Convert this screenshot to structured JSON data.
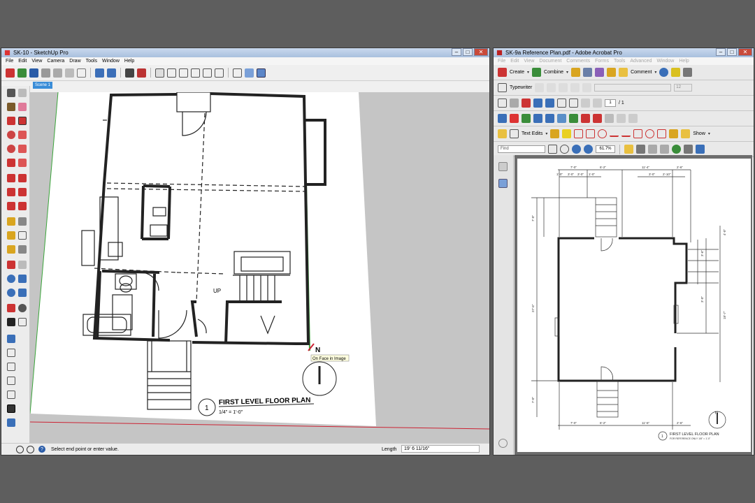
{
  "sketchup": {
    "title": "SK-10 - SketchUp Pro",
    "menu": [
      "File",
      "Edit",
      "View",
      "Camera",
      "Draw",
      "Tools",
      "Window",
      "Help"
    ],
    "scene_tab": "Scene 1",
    "plan_label": "UP",
    "plan_title": "FIRST LEVEL FLOOR PLAN",
    "plan_scale": "1/4\" = 1'-0\"",
    "plan_number": "1",
    "north_label": "N",
    "tooltip": "On Face in Image",
    "status_text": "Select end point or enter value.",
    "length_label": "Length",
    "length_value": "19' 6 11/16\""
  },
  "acrobat": {
    "title": "SK-9a Reference Plan.pdf - Adobe Acrobat Pro",
    "menu": [
      "File",
      "Edit",
      "View",
      "Document",
      "Comments",
      "Forms",
      "Tools",
      "Advanced",
      "Window",
      "Help"
    ],
    "create_label": "Create",
    "combine_label": "Combine",
    "comment_label": "Comment",
    "typewriter_label": "Typewriter",
    "font_size": "12",
    "page_current": "1",
    "page_total": "/ 1",
    "text_edits_label": "Text Edits",
    "show_label": "Show",
    "find_placeholder": "Find",
    "zoom": "61.7%",
    "ref_plan_title": "FIRST LEVEL FLOOR PLAN",
    "ref_plan_subtitle": "FOR REFERENCE ONLY  1/8\" = 1'-0\"",
    "ref_plan_number": "1",
    "ref_north": "N",
    "dim_top": [
      "7'-0\"",
      "6'-2\"",
      "11'-4\"",
      "2'-6\""
    ],
    "dim_top2": [
      "1'-0\"",
      "3'-0\"",
      "3'-0\"",
      "1'-0\"",
      "3'-0\"",
      "2'-10\""
    ],
    "dim_bottom": [
      "7'-0\"",
      "6'-2\"",
      "11'-6\"",
      "2'-6\""
    ],
    "dim_left": [
      "27'-6\"",
      "7'-0\"",
      "7'-0\""
    ],
    "dim_right": [
      "3'-6\"",
      "3'-0\"",
      "18'-7\"",
      "4'-0\""
    ]
  }
}
